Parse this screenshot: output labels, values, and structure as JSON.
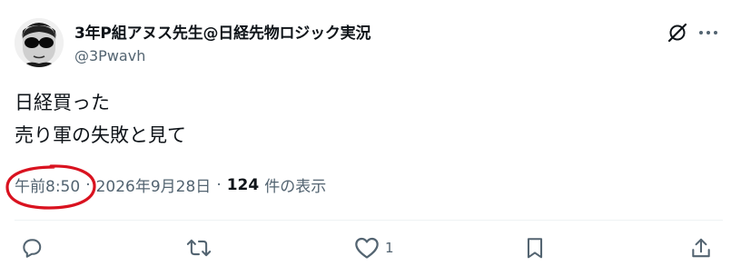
{
  "tweet": {
    "display_name": "3年P組アヌス先生@日経先物ロジック実況",
    "handle": "@3Pwavh",
    "text_lines": [
      "日経買った",
      "売り軍の失敗と見て"
    ],
    "time": "午前8:50",
    "separator": "·",
    "date": "2026年9月28日",
    "views_count": "124",
    "views_label": "件の表示"
  },
  "actions": {
    "reply_icon": "reply-icon",
    "retweet_icon": "retweet-icon",
    "like_icon": "heart-icon",
    "like_count": "1",
    "bookmark_icon": "bookmark-icon",
    "share_icon": "share-icon"
  },
  "header_icons": {
    "grok": "grok-icon",
    "more": "more-icon"
  },
  "colors": {
    "text_primary": "#0f1419",
    "text_secondary": "#536471",
    "annotation_circle": "#d9121f"
  }
}
